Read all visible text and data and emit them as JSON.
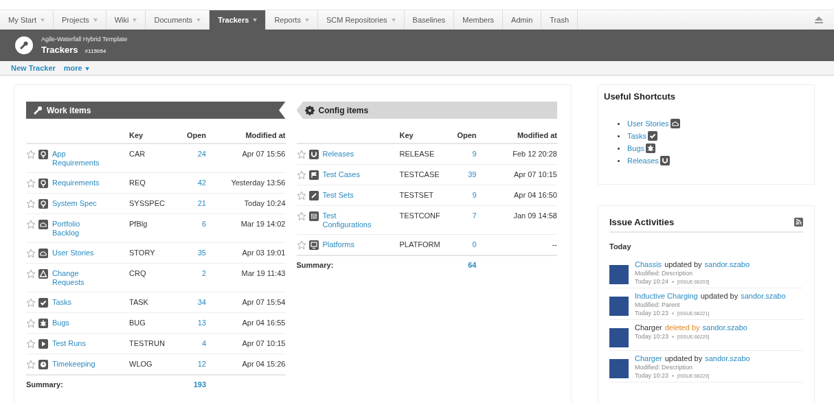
{
  "tabs": [
    {
      "label": "My Start",
      "dropdown": true,
      "selected": false
    },
    {
      "label": "Projects",
      "dropdown": true,
      "selected": false
    },
    {
      "label": "Wiki",
      "dropdown": true,
      "selected": false
    },
    {
      "label": "Documents",
      "dropdown": true,
      "selected": false
    },
    {
      "label": "Trackers",
      "dropdown": true,
      "selected": true
    },
    {
      "label": "Reports",
      "dropdown": true,
      "selected": false
    },
    {
      "label": "SCM Repositories",
      "dropdown": true,
      "selected": false
    },
    {
      "label": "Baselines",
      "dropdown": false,
      "selected": false
    },
    {
      "label": "Members",
      "dropdown": false,
      "selected": false
    },
    {
      "label": "Admin",
      "dropdown": false,
      "selected": false
    },
    {
      "label": "Trash",
      "dropdown": false,
      "selected": false
    }
  ],
  "header": {
    "project": "Agile-Waterfall Hybrid Template",
    "title": "Trackers",
    "id": "#115054"
  },
  "actions": [
    {
      "label": "New Tracker",
      "dropdown": false
    },
    {
      "label": "more",
      "dropdown": true
    }
  ],
  "sections": [
    {
      "title": "Work items",
      "kind": "work",
      "columns": [
        "Key",
        "Open",
        "Modified at"
      ],
      "rows": [
        {
          "name": "App Requirements",
          "kind": "bulb",
          "key": "CAR",
          "open": "24",
          "modified": "Apr 07 15:56"
        },
        {
          "name": "Requirements",
          "kind": "bulb",
          "key": "REQ",
          "open": "42",
          "modified": "Yesterday 13:56"
        },
        {
          "name": "System Spec",
          "kind": "bulb",
          "key": "SYSSPEC",
          "open": "21",
          "modified": "Today 10:24"
        },
        {
          "name": "Portfolio Backlog",
          "kind": "cloud",
          "key": "PfBlg",
          "open": "6",
          "modified": "Mar 19 14:02"
        },
        {
          "name": "User Stories",
          "kind": "cloud",
          "key": "STORY",
          "open": "35",
          "modified": "Apr 03 19:01"
        },
        {
          "name": "Change Requests",
          "kind": "triangle",
          "key": "CRQ",
          "open": "2",
          "modified": "Mar 19 11:43"
        },
        {
          "name": "Tasks",
          "kind": "check",
          "key": "TASK",
          "open": "34",
          "modified": "Apr 07 15:54"
        },
        {
          "name": "Bugs",
          "kind": "bug",
          "key": "BUG",
          "open": "13",
          "modified": "Apr 04 16:55"
        },
        {
          "name": "Test Runs",
          "kind": "play",
          "key": "TESTRUN",
          "open": "4",
          "modified": "Apr 07 10:15"
        },
        {
          "name": "Timekeeping",
          "kind": "clock",
          "key": "WLOG",
          "open": "12",
          "modified": "Apr 04 15:26"
        }
      ],
      "summary_label": "Summary:",
      "summary": "193"
    },
    {
      "title": "Config items",
      "kind": "config",
      "columns": [
        "Key",
        "Open",
        "Modified at"
      ],
      "rows": [
        {
          "name": "Releases",
          "kind": "release",
          "key": "RELEASE",
          "open": "9",
          "modified": "Feb 12 20:28"
        },
        {
          "name": "Test Cases",
          "kind": "flag",
          "key": "TESTCASE",
          "open": "39",
          "modified": "Apr 07 10:15"
        },
        {
          "name": "Test Sets",
          "kind": "link",
          "key": "TESTSET",
          "open": "9",
          "modified": "Apr 04 16:50"
        },
        {
          "name": "Test Configurations",
          "kind": "sliders",
          "key": "TESTCONF",
          "open": "7",
          "modified": "Jan 09 14:58"
        },
        {
          "name": "Platforms",
          "kind": "monitor",
          "key": "PLATFORM",
          "open": "0",
          "modified": "--"
        }
      ],
      "summary_label": "Summary:",
      "summary": "64"
    }
  ],
  "shortcuts": {
    "title": "Useful Shortcuts",
    "items": [
      {
        "label": "User Stories",
        "kind": "cloud"
      },
      {
        "label": "Tasks",
        "kind": "check"
      },
      {
        "label": "Bugs",
        "kind": "bug"
      },
      {
        "label": "Releases",
        "kind": "release"
      }
    ]
  },
  "activities": {
    "title": "Issue Activities",
    "day": "Today",
    "items": [
      {
        "subject": "Chassis",
        "subject_link": true,
        "action": "updated by",
        "deleted": false,
        "user": "sandor.szabo",
        "detail": "Modified: Description",
        "time": "Today 10:24",
        "issue": "[ISSUE:66203]"
      },
      {
        "subject": "Inductive Charging",
        "subject_link": true,
        "action": "updated by",
        "deleted": false,
        "user": "sandor.szabo",
        "detail": "Modified: Parent",
        "time": "Today 10:23",
        "issue": "[ISSUE:66221]"
      },
      {
        "subject": "Charger",
        "subject_link": false,
        "action": "deleted by",
        "deleted": true,
        "user": "sandor.szabo",
        "time": "Today 10:23",
        "issue": "[ISSUE:66220]"
      },
      {
        "subject": "Charger",
        "subject_link": true,
        "action": "updated by",
        "deleted": false,
        "user": "sandor.szabo",
        "detail": "Modified: Description",
        "time": "Today 10:23",
        "issue": "[ISSUE:66220]"
      }
    ]
  }
}
